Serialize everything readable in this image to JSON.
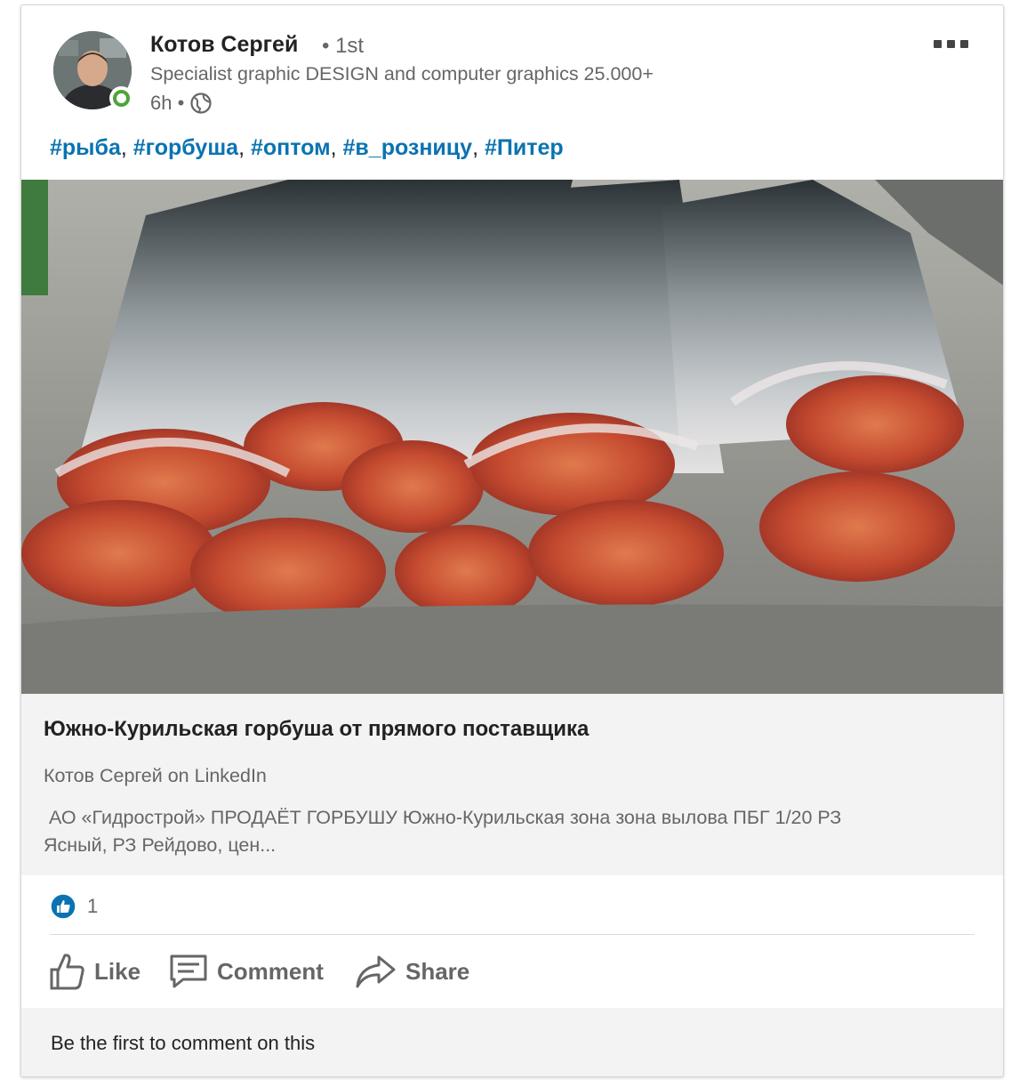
{
  "post": {
    "author_name": "Котов Сергей",
    "degree": "• 1st",
    "headline": "Specialist graphic DESIGN and computer graphics 25.000+",
    "time": "6h •",
    "hashtags": [
      "#рыба",
      "#горбуша",
      "#оптом",
      "#в_розницу",
      "#Питер"
    ],
    "hashtag_separator": ", "
  },
  "preview": {
    "title": "Южно-Курильская горбуша от прямого поставщика",
    "source": "Котов Сергей on LinkedIn",
    "description": " АО «Гидрострой» ПРОДАЁТ ГОРБУШУ Южно-Курильская зона зона вылова ПБГ 1/20 РЗ\nЯсный, РЗ Рейдово, цен..."
  },
  "social": {
    "reaction_count": "1"
  },
  "actions": {
    "like_label": "Like",
    "comment_label": "Comment",
    "share_label": "Share"
  },
  "comments": {
    "empty_text": "Be the first to comment on this"
  },
  "icons": {
    "more": "more-horizontal-icon",
    "visibility": "globe-icon",
    "reaction": "like-reaction-icon",
    "like": "thumbs-up-icon",
    "comment": "comment-icon",
    "share": "share-arrow-icon"
  },
  "colors": {
    "hashtag": "#0b73b1",
    "presence": "#4fa33a",
    "reaction_badge": "#0b73b1",
    "secondary_text": "#666666",
    "preview_bg": "#f3f3f3"
  }
}
